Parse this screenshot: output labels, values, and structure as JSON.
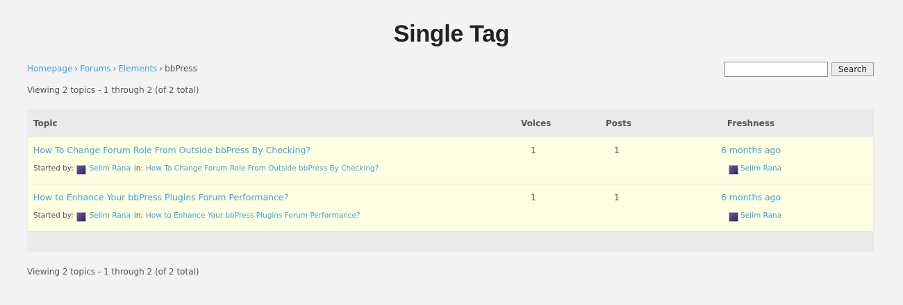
{
  "page": {
    "title": "Single Tag"
  },
  "breadcrumb": {
    "items": [
      "Homepage",
      "Forums",
      "Elements"
    ],
    "current": "bbPress",
    "separator": "›"
  },
  "search": {
    "value": "",
    "button_label": "Search"
  },
  "pagination": {
    "top": "Viewing 2 topics - 1 through 2 (of 2 total)",
    "bottom": "Viewing 2 topics - 1 through 2 (of 2 total)"
  },
  "table": {
    "headers": {
      "topic": "Topic",
      "voices": "Voices",
      "posts": "Posts",
      "freshness": "Freshness"
    },
    "started_by_label": "Started by:",
    "in_label": "in:",
    "rows": [
      {
        "title": "How To Change Forum Role From Outside bbPress By Checking?",
        "author": "Selim Rana",
        "in_forum": "How To Change Forum Role From Outside bbPress By Checking?",
        "voices": "1",
        "posts": "1",
        "freshness": "6 months ago",
        "last_author": "Selim Rana"
      },
      {
        "title": "How to Enhance Your bbPress Plugins Forum Performance?",
        "author": "Selim Rana",
        "in_forum": "How to Enhance Your bbPress Plugins Forum Performance?",
        "voices": "1",
        "posts": "1",
        "freshness": "6 months ago",
        "last_author": "Selim Rana"
      }
    ]
  },
  "colors": {
    "link": "#39a4e0",
    "row_background": "#fefee0",
    "header_background": "#eaeaea",
    "page_background": "#f3f3f3"
  }
}
